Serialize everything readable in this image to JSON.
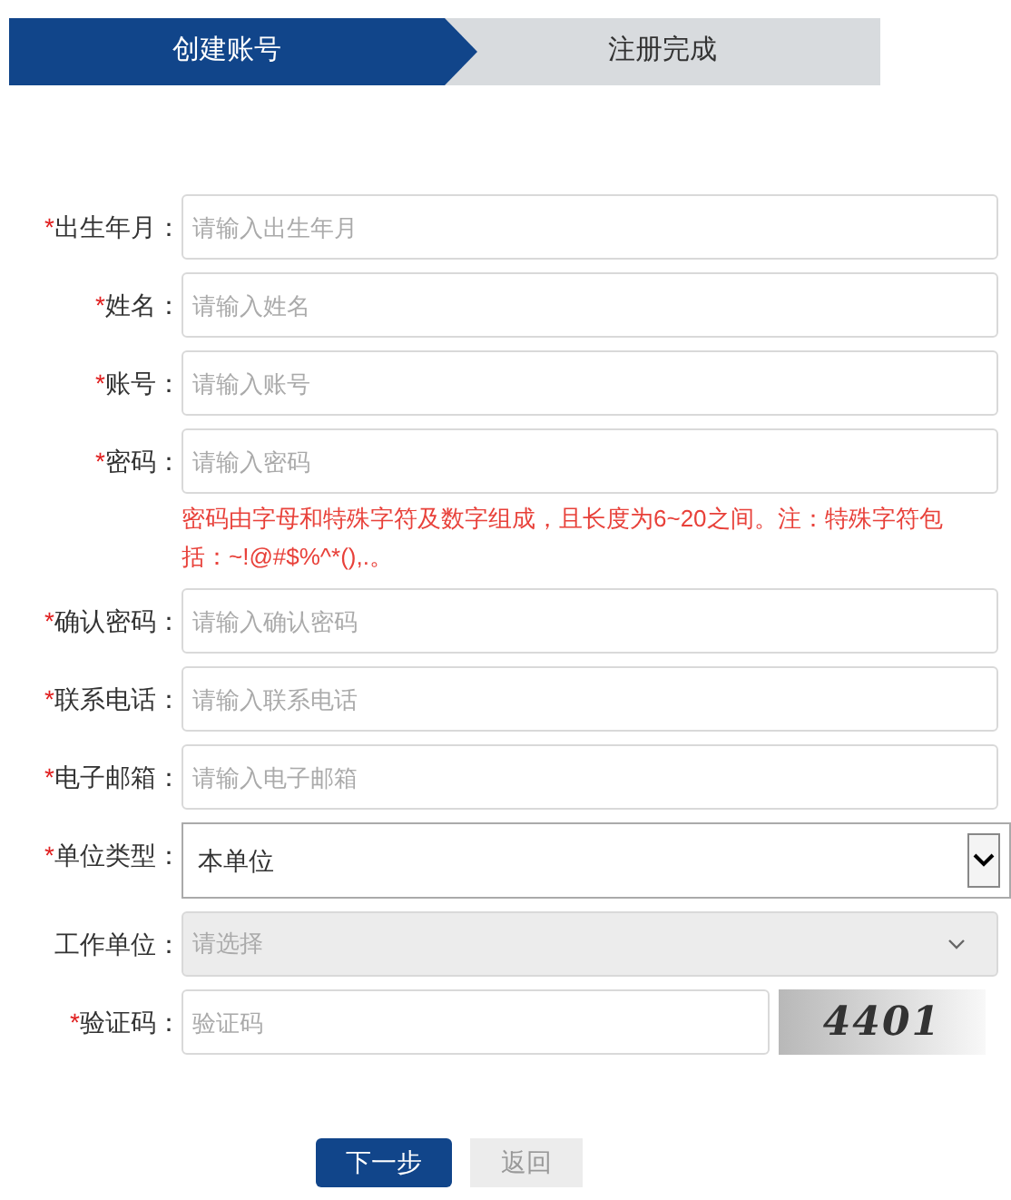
{
  "steps": [
    {
      "label": "创建账号",
      "selected": true
    },
    {
      "label": "注册完成",
      "selected": false
    }
  ],
  "fields": [
    {
      "kind": "text",
      "label": "出生年月：",
      "required_mark": "*",
      "placeholder": "请输入出生年月"
    },
    {
      "kind": "text",
      "label": "姓名：",
      "required_mark": "*",
      "placeholder": "请输入姓名"
    },
    {
      "kind": "text",
      "label": "账号：",
      "required_mark": "*",
      "placeholder": "请输入账号"
    },
    {
      "kind": "text",
      "label": "密码：",
      "required_mark": "*",
      "placeholder": "请输入密码",
      "hint": "密码由字母和特殊字符及数字组成，且长度为6~20之间。注：特殊字符包括：~!@#$%^*(),.。"
    },
    {
      "kind": "text",
      "label": "确认密码：",
      "required_mark": "*",
      "placeholder": "请输入确认密码"
    },
    {
      "kind": "text",
      "label": "联系电话：",
      "required_mark": "*",
      "placeholder": "请输入联系电话"
    },
    {
      "kind": "text",
      "label": "电子邮箱：",
      "required_mark": "*",
      "placeholder": "请输入电子邮箱"
    },
    {
      "kind": "select",
      "label": "单位类型：",
      "required_mark": "*",
      "value": "本单位",
      "disabled": false
    },
    {
      "kind": "select",
      "label": "工作单位：",
      "placeholder": "请选择",
      "disabled": true
    },
    {
      "kind": "captcha",
      "label": "验证码：",
      "required_mark": "*",
      "placeholder": "验证码",
      "captcha": "4401"
    }
  ],
  "buttons": [
    {
      "label": "下一步",
      "kind": "primary"
    },
    {
      "label": "返回",
      "kind": "secondary"
    }
  ]
}
